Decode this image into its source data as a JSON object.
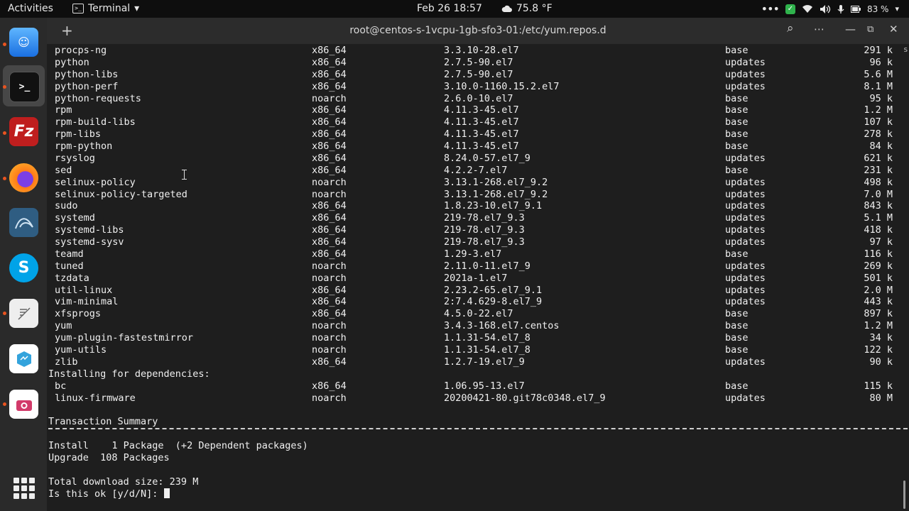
{
  "topbar": {
    "activities": "Activities",
    "app_name": "Terminal",
    "app_chevron": "▾",
    "clock": "Feb 26  18:57",
    "weather": "75.8 °F",
    "battery": "83 %",
    "icons": [
      "terminal-icon",
      "cloud-icon",
      "menu-dots-icon",
      "green-check-icon",
      "wifi-icon",
      "volume-icon",
      "mic-icon",
      "battery-icon",
      "dropdown-icon"
    ]
  },
  "dock": {
    "apps": [
      "finder",
      "terminal",
      "filezilla",
      "firefox",
      "mysql-workbench",
      "skype",
      "text-editor",
      "app-6",
      "screenshot"
    ],
    "show_apps_icon": "grid-icon"
  },
  "window": {
    "new_tab": "+",
    "title": "root@centos-s-1vcpu-1gb-sfo3-01:/etc/yum.repos.d",
    "search_icon": "⌕",
    "menu_icon": "⋯",
    "minimize_icon": "—",
    "maximize_icon": "⧉",
    "close_icon": "✕"
  },
  "packages": [
    [
      "procps-ng",
      "x86_64",
      "3.3.10-28.el7",
      "base",
      "291 k"
    ],
    [
      "python",
      "x86_64",
      "2.7.5-90.el7",
      "updates",
      "96 k"
    ],
    [
      "python-libs",
      "x86_64",
      "2.7.5-90.el7",
      "updates",
      "5.6 M"
    ],
    [
      "python-perf",
      "x86_64",
      "3.10.0-1160.15.2.el7",
      "updates",
      "8.1 M"
    ],
    [
      "python-requests",
      "noarch",
      "2.6.0-10.el7",
      "base",
      "95 k"
    ],
    [
      "rpm",
      "x86_64",
      "4.11.3-45.el7",
      "base",
      "1.2 M"
    ],
    [
      "rpm-build-libs",
      "x86_64",
      "4.11.3-45.el7",
      "base",
      "107 k"
    ],
    [
      "rpm-libs",
      "x86_64",
      "4.11.3-45.el7",
      "base",
      "278 k"
    ],
    [
      "rpm-python",
      "x86_64",
      "4.11.3-45.el7",
      "base",
      "84 k"
    ],
    [
      "rsyslog",
      "x86_64",
      "8.24.0-57.el7_9",
      "updates",
      "621 k"
    ],
    [
      "sed",
      "x86_64",
      "4.2.2-7.el7",
      "base",
      "231 k"
    ],
    [
      "selinux-policy",
      "noarch",
      "3.13.1-268.el7_9.2",
      "updates",
      "498 k"
    ],
    [
      "selinux-policy-targeted",
      "noarch",
      "3.13.1-268.el7_9.2",
      "updates",
      "7.0 M"
    ],
    [
      "sudo",
      "x86_64",
      "1.8.23-10.el7_9.1",
      "updates",
      "843 k"
    ],
    [
      "systemd",
      "x86_64",
      "219-78.el7_9.3",
      "updates",
      "5.1 M"
    ],
    [
      "systemd-libs",
      "x86_64",
      "219-78.el7_9.3",
      "updates",
      "418 k"
    ],
    [
      "systemd-sysv",
      "x86_64",
      "219-78.el7_9.3",
      "updates",
      "97 k"
    ],
    [
      "teamd",
      "x86_64",
      "1.29-3.el7",
      "base",
      "116 k"
    ],
    [
      "tuned",
      "noarch",
      "2.11.0-11.el7_9",
      "updates",
      "269 k"
    ],
    [
      "tzdata",
      "noarch",
      "2021a-1.el7",
      "updates",
      "501 k"
    ],
    [
      "util-linux",
      "x86_64",
      "2.23.2-65.el7_9.1",
      "updates",
      "2.0 M"
    ],
    [
      "vim-minimal",
      "x86_64",
      "2:7.4.629-8.el7_9",
      "updates",
      "443 k"
    ],
    [
      "xfsprogs",
      "x86_64",
      "4.5.0-22.el7",
      "base",
      "897 k"
    ],
    [
      "yum",
      "noarch",
      "3.4.3-168.el7.centos",
      "base",
      "1.2 M"
    ],
    [
      "yum-plugin-fastestmirror",
      "noarch",
      "1.1.31-54.el7_8",
      "base",
      "34 k"
    ],
    [
      "yum-utils",
      "noarch",
      "1.1.31-54.el7_8",
      "base",
      "122 k"
    ],
    [
      "zlib",
      "x86_64",
      "1.2.7-19.el7_9",
      "updates",
      "90 k"
    ]
  ],
  "deps_header": "Installing for dependencies:",
  "dependencies": [
    [
      "bc",
      "x86_64",
      "1.06.95-13.el7",
      "base",
      "115 k"
    ],
    [
      "linux-firmware",
      "noarch",
      "20200421-80.git78c0348.el7_9",
      "updates",
      "80 M"
    ]
  ],
  "summary": {
    "title": "Transaction Summary",
    "install": "Install    1 Package  (+2 Dependent packages)",
    "upgrade": "Upgrade  108 Packages",
    "total": "Total download size: 239 M",
    "prompt": "Is this ok [y/d/N]: "
  },
  "edge_chars": [
    "s",
    "",
    "",
    "",
    "",
    "",
    "",
    "",
    "",
    "",
    "",
    "",
    "",
    "",
    "",
    "",
    "",
    "",
    "",
    "",
    "",
    "",
    "",
    "",
    "",
    "",
    "",
    "",
    "",
    "",
    "",
    "",
    "",
    "",
    "",
    "",
    "",
    ""
  ]
}
